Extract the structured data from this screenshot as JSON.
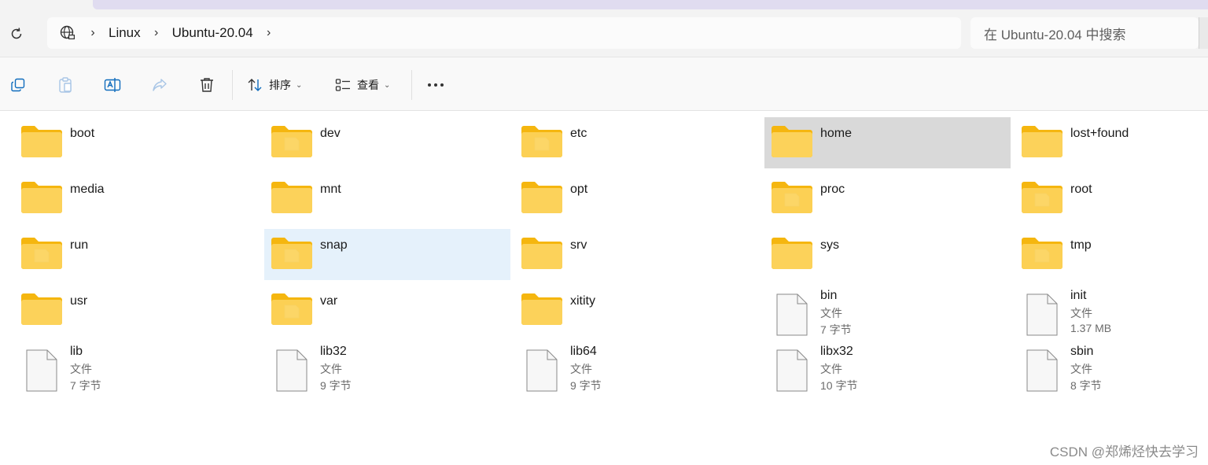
{
  "colors": {
    "folder_front": "#fcd25a",
    "folder_back": "#f5b60f",
    "hover": "#d9d9d9",
    "selected": "#e5f1fb",
    "tab_strip": "#e0dcf0"
  },
  "address": {
    "crumbs": [
      "Linux",
      "Ubuntu-20.04"
    ],
    "search_placeholder": "在 Ubuntu-20.04 中搜索"
  },
  "toolbar": {
    "sort_label": "排序",
    "view_label": "查看",
    "more_label": "•••"
  },
  "items": [
    {
      "name": "boot",
      "type": "folder",
      "state": ""
    },
    {
      "name": "dev",
      "type": "folder-doc",
      "state": ""
    },
    {
      "name": "etc",
      "type": "folder-doc",
      "state": ""
    },
    {
      "name": "home",
      "type": "folder",
      "state": "hover"
    },
    {
      "name": "lost+found",
      "type": "folder",
      "state": ""
    },
    {
      "name": "media",
      "type": "folder",
      "state": ""
    },
    {
      "name": "mnt",
      "type": "folder",
      "state": ""
    },
    {
      "name": "opt",
      "type": "folder",
      "state": ""
    },
    {
      "name": "proc",
      "type": "folder-doc",
      "state": ""
    },
    {
      "name": "root",
      "type": "folder-doc",
      "state": ""
    },
    {
      "name": "run",
      "type": "folder-doc",
      "state": ""
    },
    {
      "name": "snap",
      "type": "folder-doc",
      "state": "selected"
    },
    {
      "name": "srv",
      "type": "folder",
      "state": ""
    },
    {
      "name": "sys",
      "type": "folder",
      "state": ""
    },
    {
      "name": "tmp",
      "type": "folder-doc",
      "state": ""
    },
    {
      "name": "usr",
      "type": "folder",
      "state": ""
    },
    {
      "name": "var",
      "type": "folder-doc",
      "state": ""
    },
    {
      "name": "xitity",
      "type": "folder",
      "state": ""
    },
    {
      "name": "bin",
      "type": "file",
      "kind": "文件",
      "size": "7 字节",
      "state": ""
    },
    {
      "name": "init",
      "type": "file",
      "kind": "文件",
      "size": "1.37 MB",
      "state": ""
    },
    {
      "name": "lib",
      "type": "file",
      "kind": "文件",
      "size": "7 字节",
      "state": ""
    },
    {
      "name": "lib32",
      "type": "file",
      "kind": "文件",
      "size": "9 字节",
      "state": ""
    },
    {
      "name": "lib64",
      "type": "file",
      "kind": "文件",
      "size": "9 字节",
      "state": ""
    },
    {
      "name": "libx32",
      "type": "file",
      "kind": "文件",
      "size": "10 字节",
      "state": ""
    },
    {
      "name": "sbin",
      "type": "file",
      "kind": "文件",
      "size": "8 字节",
      "state": ""
    }
  ],
  "watermark": "CSDN @郑烯烃快去学习"
}
